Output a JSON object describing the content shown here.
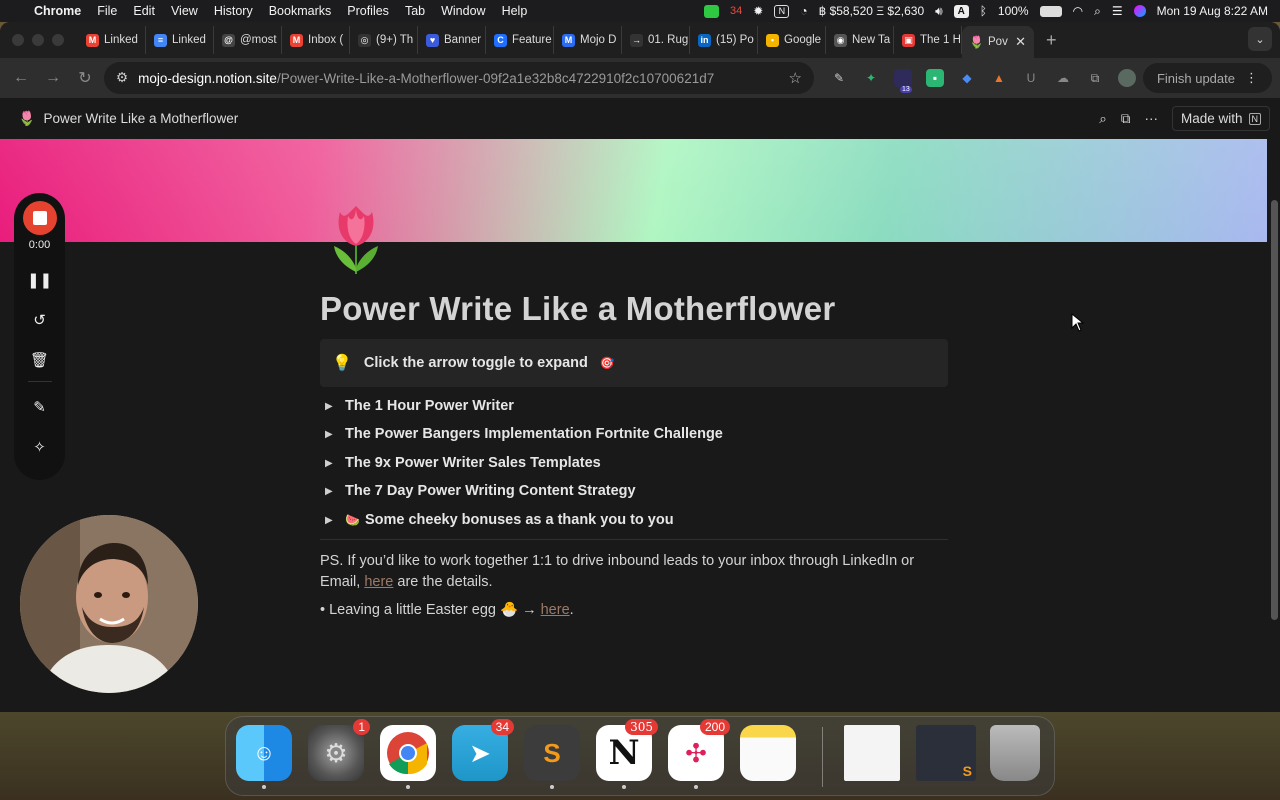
{
  "menubar": {
    "app": "Chrome",
    "menus": [
      "File",
      "Edit",
      "View",
      "History",
      "Bookmarks",
      "Profiles",
      "Tab",
      "Window",
      "Help"
    ],
    "crypto": "฿ $58,520 Ξ $2,630",
    "battery": "100%",
    "datetime": "Mon 19 Aug  8:22 AM",
    "status_badge": "34"
  },
  "tabs": [
    {
      "label": "Linked",
      "color": "#ea4335",
      "glyph": "M"
    },
    {
      "label": "Linked",
      "color": "#4285f4",
      "glyph": "≡"
    },
    {
      "label": "@most",
      "color": "#444",
      "glyph": "@"
    },
    {
      "label": "Inbox (",
      "color": "#ea4335",
      "glyph": "M"
    },
    {
      "label": "(9+) Th",
      "color": "#333",
      "glyph": "◎"
    },
    {
      "label": "Banner",
      "color": "#3b5bdb",
      "glyph": "♥"
    },
    {
      "label": "Feature",
      "color": "#1e6fff",
      "glyph": "C"
    },
    {
      "label": "Mojo D",
      "color": "#2a6df4",
      "glyph": "M"
    },
    {
      "label": "01. Rug",
      "color": "#333",
      "glyph": "→"
    },
    {
      "label": "(15) Po",
      "color": "#0a66c2",
      "glyph": "in"
    },
    {
      "label": "Google",
      "color": "#f4b400",
      "glyph": "▪"
    },
    {
      "label": "New Ta",
      "color": "#555",
      "glyph": "◉"
    },
    {
      "label": "The 1 H",
      "color": "#e53935",
      "glyph": "▣"
    }
  ],
  "active_tab": {
    "label": "Pov",
    "close": "✕"
  },
  "url": {
    "domain": "mojo-design.notion.site",
    "path": "/Power-Write-Like-a-Motherflower-09f2a1e32b8c4722910f2c10700621d7"
  },
  "extension_badge": "13",
  "finish_update": "Finish update",
  "notion": {
    "page_title_small": "Power Write Like a Motherflower",
    "made_with": "Made with",
    "title": "Power Write Like a Motherflower",
    "callout": "Click the arrow toggle to expand",
    "toggles": [
      "The 1 Hour Power Writer",
      "The Power Bangers Implementation Fortnite Challenge",
      "The 9x Power Writer Sales Templates",
      "The 7 Day Power Writing Content Strategy",
      "Some cheeky bonuses as a thank you to you"
    ],
    "ps_text_1": "PS. If you’d like to work together 1:1 to drive inbound leads to your inbox through LinkedIn or Email, ",
    "ps_link": "here",
    "ps_text_2": " are the details.",
    "egg_text": "• Leaving a little Easter egg 🐣 → ",
    "egg_link": "here",
    "egg_end": "."
  },
  "recorder": {
    "time": "0:00"
  },
  "dock": [
    {
      "name": "Finder",
      "badge": ""
    },
    {
      "name": "System Settings",
      "badge": "1"
    },
    {
      "name": "Chrome",
      "badge": ""
    },
    {
      "name": "Telegram",
      "badge": "34"
    },
    {
      "name": "Sublime Text",
      "badge": ""
    },
    {
      "name": "Notion",
      "badge": "305"
    },
    {
      "name": "Slack",
      "badge": "200"
    },
    {
      "name": "Notes",
      "badge": ""
    }
  ]
}
